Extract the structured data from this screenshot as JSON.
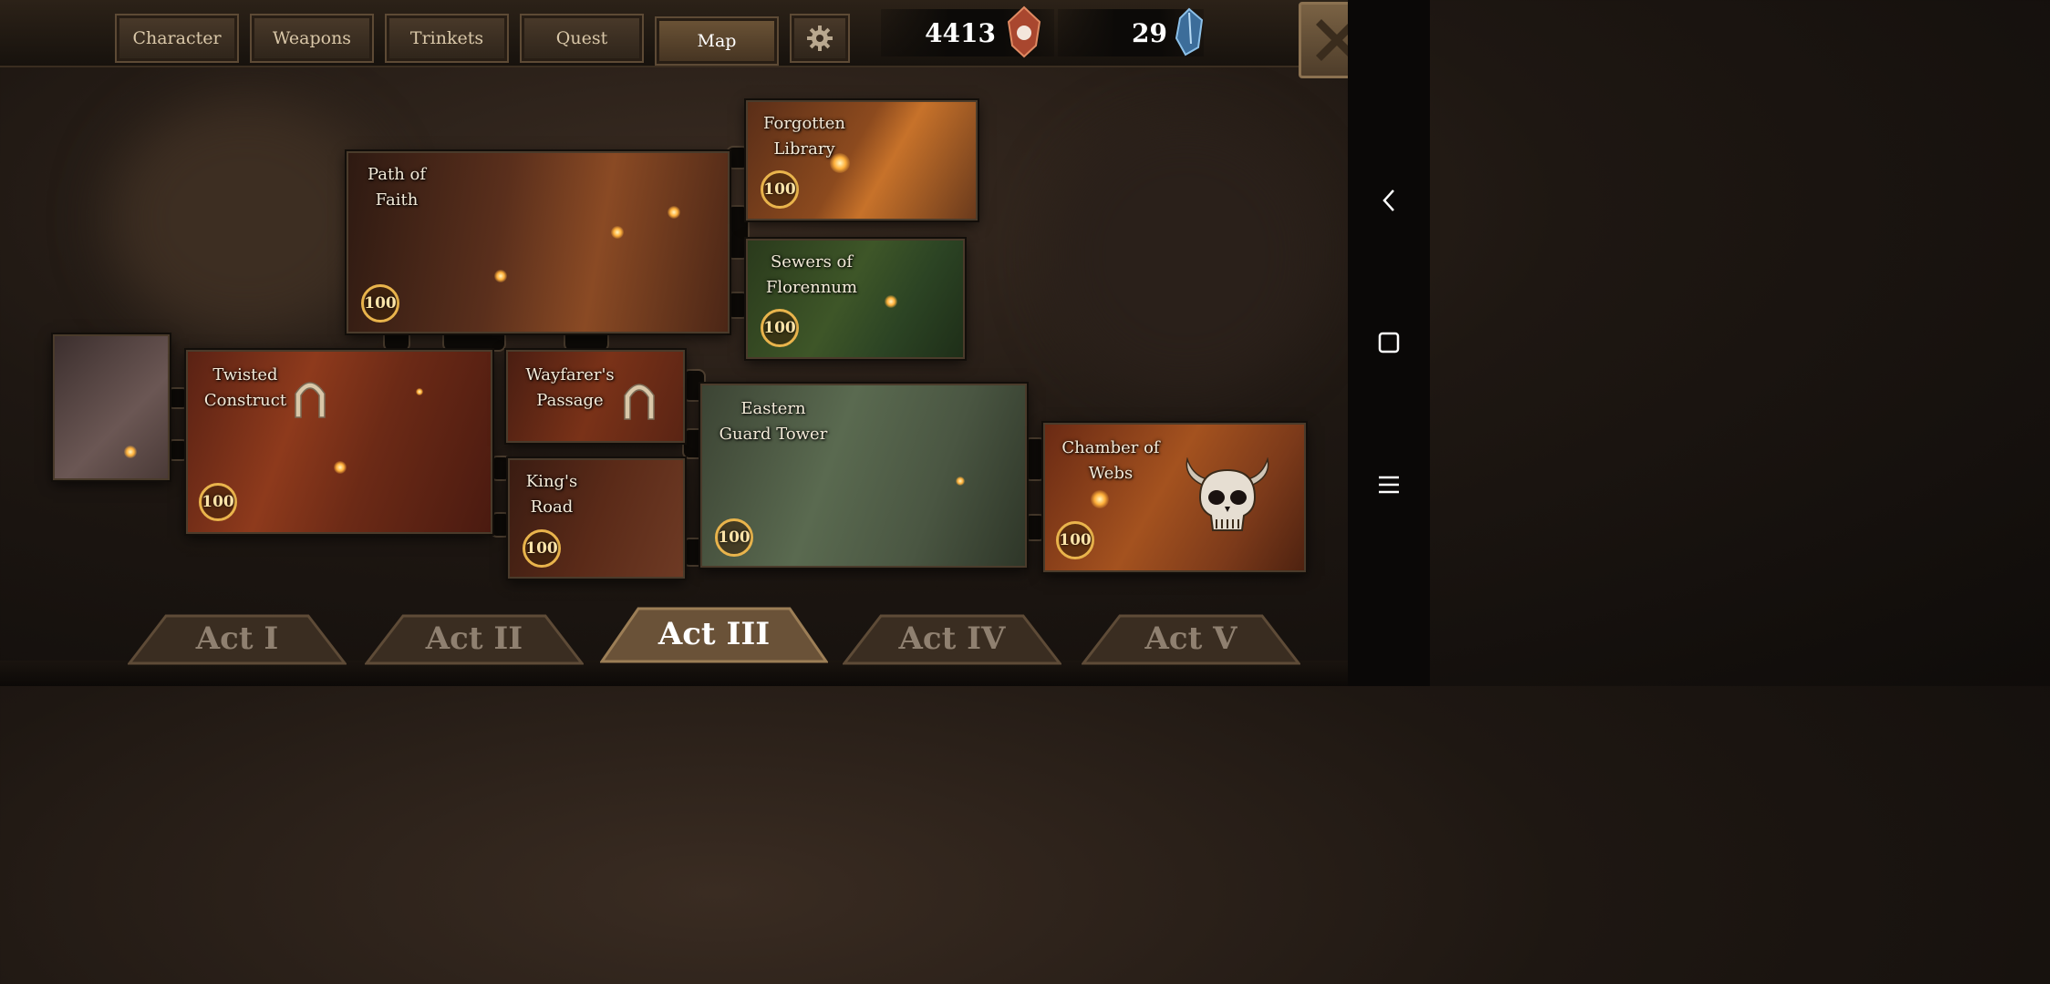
{
  "top_tabs": [
    {
      "label": "Character"
    },
    {
      "label": "Weapons"
    },
    {
      "label": "Trinkets"
    },
    {
      "label": "Quest"
    },
    {
      "label": "Map",
      "active": true
    }
  ],
  "settings_icon": "gear-icon",
  "currency": {
    "gold": {
      "value": "4413",
      "icon": "red-gem-icon"
    },
    "crystals": {
      "value": "29",
      "icon": "blue-crystal-icon"
    }
  },
  "close_icon": "close-icon",
  "system_nav": [
    "back-icon",
    "home-square-icon",
    "menu-icon"
  ],
  "rooms": {
    "path_of_faith": {
      "name_line1": "Path of",
      "name_line2": "Faith",
      "level": "100"
    },
    "forgotten_library": {
      "name_line1": "Forgotten",
      "name_line2": "Library",
      "level": "100"
    },
    "sewers_of_florennum": {
      "name_line1": "Sewers of",
      "name_line2": "Florennum",
      "level": "100"
    },
    "twisted_construct": {
      "name_line1": "Twisted",
      "name_line2": "Construct",
      "level": "100",
      "icon": "portal-arch-icon"
    },
    "wayfarers_passage": {
      "name_line1": "Wayfarer's",
      "name_line2": "Passage",
      "icon": "portal-arch-icon"
    },
    "kings_road": {
      "name_line1": "King's",
      "name_line2": "Road",
      "level": "100"
    },
    "eastern_guard_tower": {
      "name_line1": "Eastern",
      "name_line2": "Guard Tower",
      "level": "100"
    },
    "chamber_of_webs": {
      "name_line1": "Chamber of",
      "name_line2": "Webs",
      "level": "100",
      "icon": "horned-skull-boss-icon"
    }
  },
  "acts": [
    {
      "label": "Act I"
    },
    {
      "label": "Act II"
    },
    {
      "label": "Act III",
      "active": true
    },
    {
      "label": "Act IV"
    },
    {
      "label": "Act V"
    }
  ],
  "colors": {
    "accent_gold": "#e9b44c",
    "tab_active": "#6c5437",
    "text_light": "#f3ead8"
  }
}
